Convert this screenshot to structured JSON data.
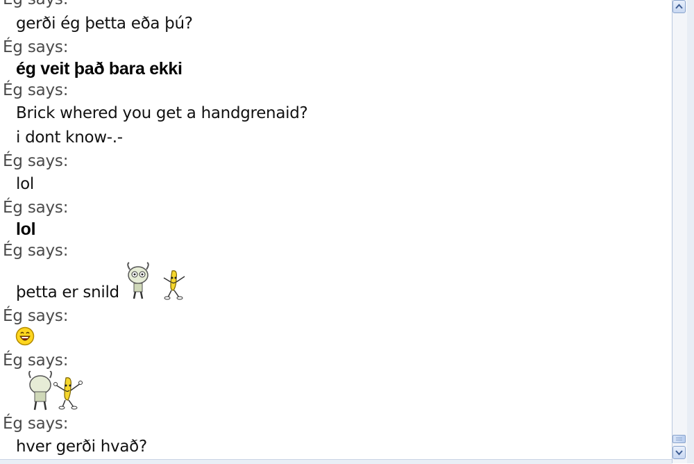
{
  "conversation": {
    "messages": [
      {
        "sender": "Ég says:",
        "lines": [
          "gerði ég þetta eða þú?"
        ]
      },
      {
        "sender": "Ég says:",
        "lines": [
          "ég veit það bara ekki"
        ],
        "bold": true
      },
      {
        "sender": "Ég says:",
        "lines": [
          "Brick whered you get a handgrenaid?",
          "i dont know-.-"
        ]
      },
      {
        "sender": "Ég says:",
        "lines": [
          "lol"
        ]
      },
      {
        "sender": "Ég says:",
        "lines": [
          "lol"
        ],
        "bold": true
      },
      {
        "sender": "Ég says:",
        "lines": [
          "þetta er snild"
        ],
        "emoticons": [
          "gir-robot-icon",
          "dancing-banana-icon"
        ]
      },
      {
        "sender": "Ég says:",
        "emoticons": [
          "laughing-smiley-icon"
        ]
      },
      {
        "sender": "Ég says:",
        "emoticons": [
          "gir-robot-icon",
          "dancing-banana-icon"
        ]
      },
      {
        "sender": "Ég says:",
        "lines": [
          "hver gerði hvað?"
        ]
      }
    ]
  },
  "colors": {
    "sender_text": "#4a4a4a",
    "message_text": "#111111",
    "scrollbar_border": "#8aa4cc",
    "scrollbar_face": "#c8d8f2"
  },
  "scrollbar": {
    "up_icon": "chevron-up-icon",
    "down_icon": "chevron-down-icon",
    "position_fraction": 0.98
  }
}
